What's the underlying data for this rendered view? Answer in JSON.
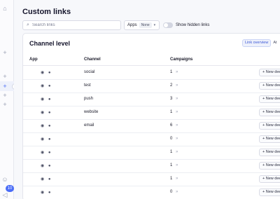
{
  "page": {
    "title": "Custom links"
  },
  "rail": {
    "notification_count": "10"
  },
  "filters": {
    "search_placeholder": "Search links",
    "apps_label": "Apps",
    "apps_value": "None",
    "hidden_toggle_label": "Show hidden links"
  },
  "card": {
    "title": "Channel level",
    "tabs": [
      "Link overview",
      "At"
    ]
  },
  "table": {
    "headers": [
      "App",
      "Channel",
      "Campaigns"
    ],
    "new_button_label": "+ New deep link",
    "rows": [
      {
        "channel": "social",
        "campaigns": "1"
      },
      {
        "channel": "test",
        "campaigns": "2"
      },
      {
        "channel": "push",
        "campaigns": "3"
      },
      {
        "channel": "website",
        "campaigns": "1"
      },
      {
        "channel": "email",
        "campaigns": "6"
      },
      {
        "channel": "",
        "campaigns": "0"
      },
      {
        "channel": "",
        "campaigns": "1"
      },
      {
        "channel": "",
        "campaigns": "1"
      },
      {
        "channel": "",
        "campaigns": "1"
      },
      {
        "channel": "",
        "campaigns": "0"
      }
    ]
  },
  "icons": {
    "app_android": "android-icon",
    "app_apple": "apple-icon",
    "campaign_arrow": "double-chevron-right-icon"
  }
}
